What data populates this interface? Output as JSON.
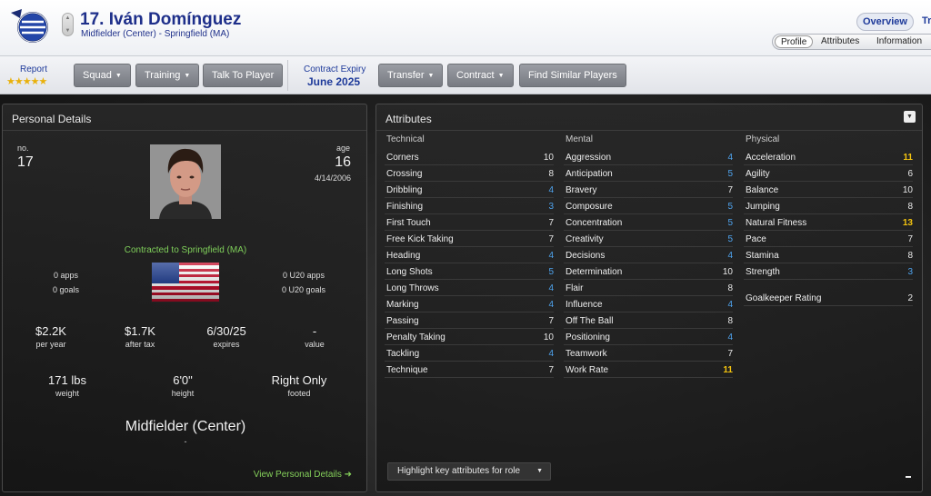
{
  "header": {
    "player_title": "17. Iván Domínguez",
    "subtitle": "Midfielder (Center) - Springfield (MA)",
    "nav_overview": "Overview",
    "nav_truncated": "Tr",
    "subtabs": [
      "Profile",
      "Attributes",
      "Information"
    ]
  },
  "toolbar": {
    "report_label": "Report",
    "report_stars": "★★★★★",
    "buttons": {
      "squad": "Squad",
      "training": "Training",
      "talk": "Talk To Player",
      "transfer": "Transfer",
      "contract": "Contract",
      "similar": "Find Similar Players"
    },
    "contract_expiry_label": "Contract Expiry",
    "contract_expiry_value": "June 2025"
  },
  "personal": {
    "title": "Personal Details",
    "no_label": "no.",
    "no_value": "17",
    "age_label": "age",
    "age_value": "16",
    "dob": "4/14/2006",
    "contracted": "Contracted to Springfield (MA)",
    "apps": "0 apps",
    "goals": "0 goals",
    "u20_apps": "0 U20 apps",
    "u20_goals": "0 U20 goals",
    "wage_value": "$2.2K",
    "wage_label": "per year",
    "aftertax_value": "$1.7K",
    "aftertax_label": "after tax",
    "expires_value": "6/30/25",
    "expires_label": "expires",
    "value_value": "-",
    "value_label": "value",
    "weight_value": "171 lbs",
    "weight_label": "weight",
    "height_value": "6'0\"",
    "height_label": "height",
    "footed_value": "Right Only",
    "footed_label": "footed",
    "position": "Midfielder (Center)",
    "position_sub": "-",
    "view_link": "View Personal Details ➜"
  },
  "attributes": {
    "title": "Attributes",
    "technical_title": "Technical",
    "mental_title": "Mental",
    "physical_title": "Physical",
    "technical": [
      {
        "name": "Corners",
        "value": "10",
        "tone": "white"
      },
      {
        "name": "Crossing",
        "value": "8",
        "tone": "white"
      },
      {
        "name": "Dribbling",
        "value": "4",
        "tone": "blue"
      },
      {
        "name": "Finishing",
        "value": "3",
        "tone": "blue"
      },
      {
        "name": "First Touch",
        "value": "7",
        "tone": "white"
      },
      {
        "name": "Free Kick Taking",
        "value": "7",
        "tone": "white"
      },
      {
        "name": "Heading",
        "value": "4",
        "tone": "blue"
      },
      {
        "name": "Long Shots",
        "value": "5",
        "tone": "blue"
      },
      {
        "name": "Long Throws",
        "value": "4",
        "tone": "blue"
      },
      {
        "name": "Marking",
        "value": "4",
        "tone": "blue"
      },
      {
        "name": "Passing",
        "value": "7",
        "tone": "white"
      },
      {
        "name": "Penalty Taking",
        "value": "10",
        "tone": "white"
      },
      {
        "name": "Tackling",
        "value": "4",
        "tone": "blue"
      },
      {
        "name": "Technique",
        "value": "7",
        "tone": "white"
      }
    ],
    "mental": [
      {
        "name": "Aggression",
        "value": "4",
        "tone": "blue"
      },
      {
        "name": "Anticipation",
        "value": "5",
        "tone": "blue"
      },
      {
        "name": "Bravery",
        "value": "7",
        "tone": "white"
      },
      {
        "name": "Composure",
        "value": "5",
        "tone": "blue"
      },
      {
        "name": "Concentration",
        "value": "5",
        "tone": "blue"
      },
      {
        "name": "Creativity",
        "value": "5",
        "tone": "blue"
      },
      {
        "name": "Decisions",
        "value": "4",
        "tone": "blue"
      },
      {
        "name": "Determination",
        "value": "10",
        "tone": "white"
      },
      {
        "name": "Flair",
        "value": "8",
        "tone": "white"
      },
      {
        "name": "Influence",
        "value": "4",
        "tone": "blue"
      },
      {
        "name": "Off The Ball",
        "value": "8",
        "tone": "white"
      },
      {
        "name": "Positioning",
        "value": "4",
        "tone": "blue"
      },
      {
        "name": "Teamwork",
        "value": "7",
        "tone": "white"
      },
      {
        "name": "Work Rate",
        "value": "11",
        "tone": "yellow"
      }
    ],
    "physical": [
      {
        "name": "Acceleration",
        "value": "11",
        "tone": "yellow"
      },
      {
        "name": "Agility",
        "value": "6",
        "tone": "white"
      },
      {
        "name": "Balance",
        "value": "10",
        "tone": "white"
      },
      {
        "name": "Jumping",
        "value": "8",
        "tone": "white"
      },
      {
        "name": "Natural Fitness",
        "value": "13",
        "tone": "yellow"
      },
      {
        "name": "Pace",
        "value": "7",
        "tone": "white"
      },
      {
        "name": "Stamina",
        "value": "8",
        "tone": "white"
      },
      {
        "name": "Strength",
        "value": "3",
        "tone": "blue"
      }
    ],
    "goalkeeper": {
      "name": "Goalkeeper Rating",
      "value": "2",
      "tone": "white"
    },
    "highlight_select": "Highlight key attributes for role",
    "bottom_dash": "-"
  },
  "icons": {
    "badge": "club-badge-icon",
    "flag": "usa-flag-icon",
    "collapse": "collapse-toggle-icon"
  },
  "colors": {
    "brand_blue": "#1e2f8a",
    "attr_blue": "#4fa4ef",
    "attr_yellow": "#f4c40f",
    "link_green": "#84cf5a"
  }
}
